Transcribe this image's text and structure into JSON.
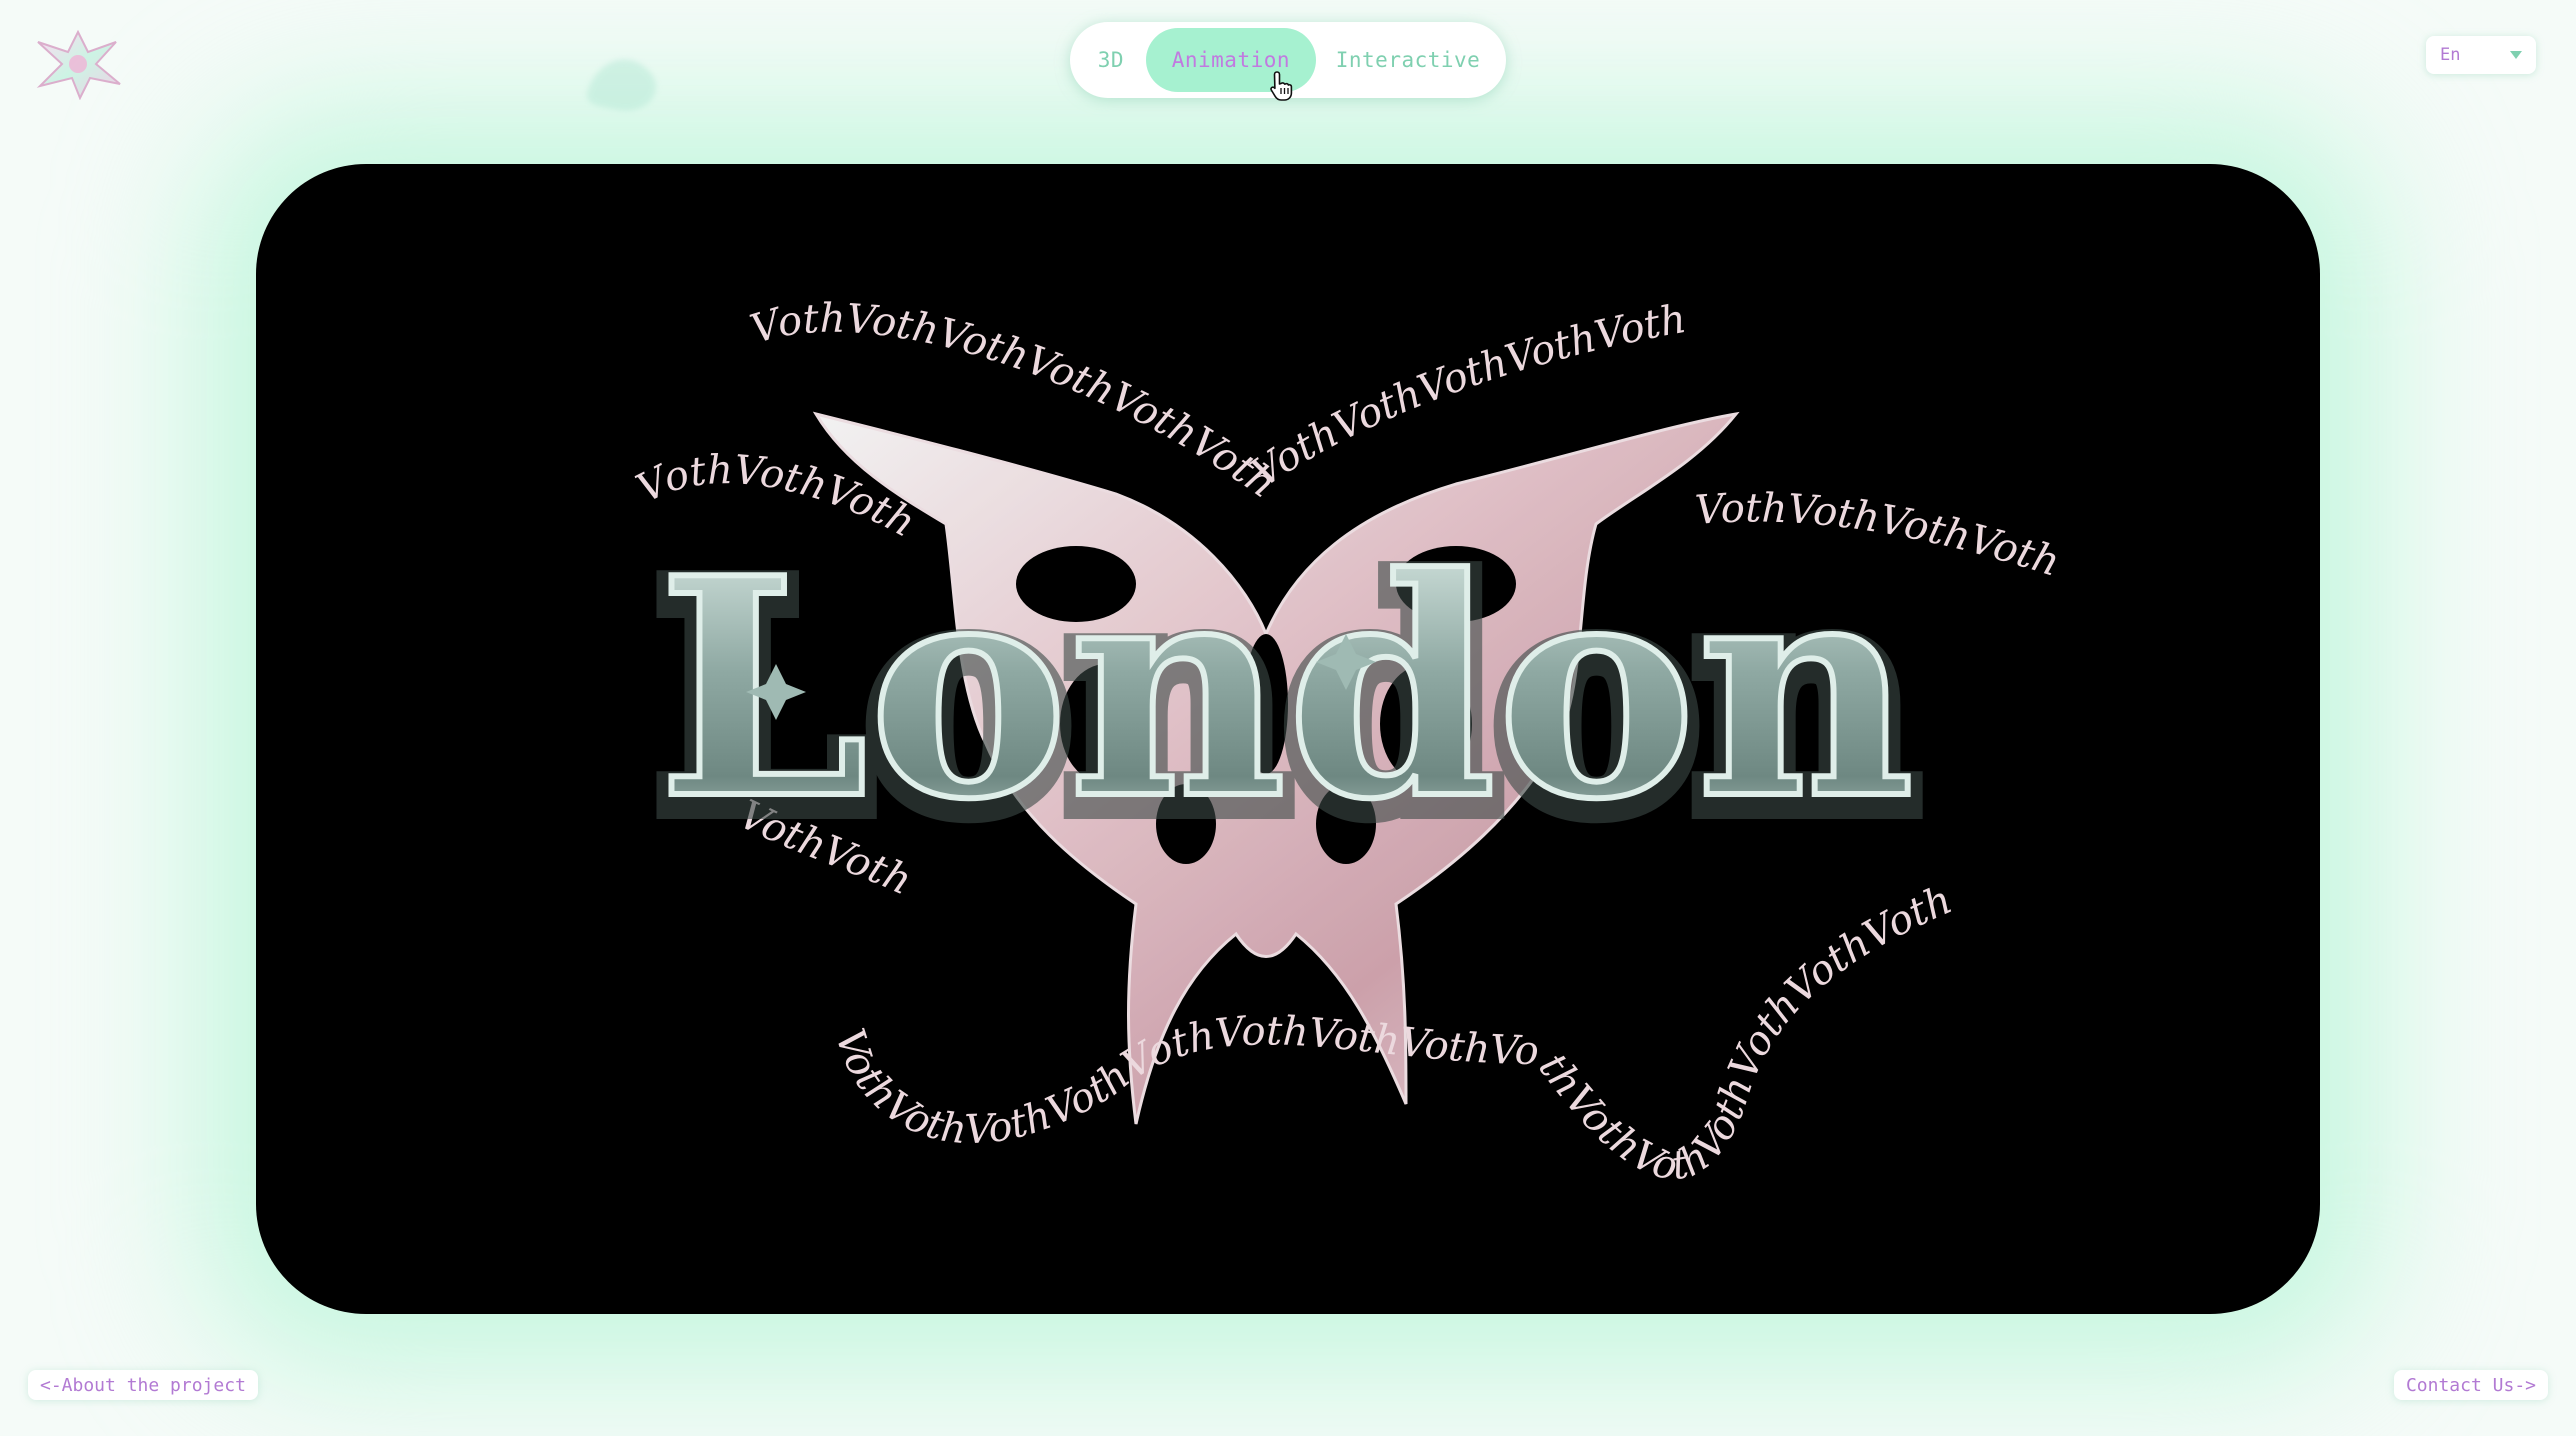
{
  "tabs": [
    {
      "id": "3d",
      "label": "3D",
      "active": false
    },
    {
      "id": "animation",
      "label": "Animation",
      "active": true
    },
    {
      "id": "interactive",
      "label": "Interactive",
      "active": false
    }
  ],
  "language": {
    "selected": "En"
  },
  "artwork": {
    "wordmark": "London",
    "ring_word": "Voth"
  },
  "footer": {
    "about_link": "<-About the project",
    "contact_link": "Contact Us->"
  },
  "colors": {
    "accent_mint": "#a6f1d0",
    "accent_purple": "#c17ae0",
    "tab_text": "#7fd0b0",
    "stage_bg": "#000000",
    "chrome_letters": "#9fb6b0",
    "pink_chrome": "#e9c6cc"
  },
  "icons": {
    "logo": "chrome-star-logo-icon",
    "cursor": "hand-pointer-icon",
    "dropdown": "chevron-down-icon"
  }
}
